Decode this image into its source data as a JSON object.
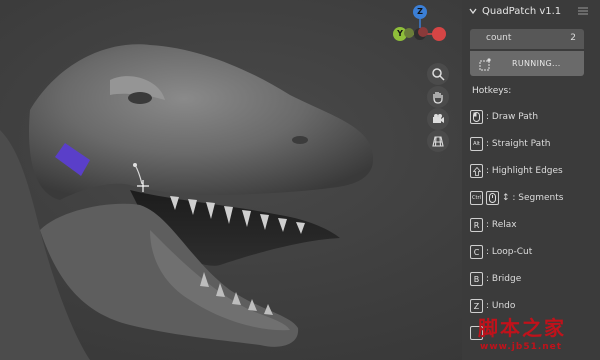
{
  "panel": {
    "title": "QuadPatch v1.1",
    "count_label": "count",
    "count_value": "2",
    "status": "RUNNING...",
    "hotkeys_title": "Hotkeys:",
    "hotkeys": [
      {
        "key": "",
        "icon": "mouse-left-icon",
        "label": ": Draw Path"
      },
      {
        "key": "Alt",
        "icon": "",
        "label": ": Straight Path"
      },
      {
        "key": "",
        "icon": "shift-arrow-icon",
        "label": ": Highlight Edges"
      },
      {
        "key": "Ctrl",
        "icon": "mouse-wheel-icon",
        "label": "↕ : Segments"
      },
      {
        "key": "R",
        "icon": "",
        "label": ": Relax"
      },
      {
        "key": "C",
        "icon": "",
        "label": ": Loop-Cut"
      },
      {
        "key": "B",
        "icon": "",
        "label": ": Bridge"
      },
      {
        "key": "Z",
        "icon": "",
        "label": ": Undo"
      }
    ]
  },
  "gizmo": {
    "z": "Z",
    "y": "Y"
  },
  "watermark": {
    "text": "脚本之家",
    "url": "www.jb51.net"
  },
  "colors": {
    "patch": "#5a3fc9",
    "accent_z": "#3b7fd6",
    "accent_y": "#8fbf3a",
    "accent_x": "#d64545"
  }
}
